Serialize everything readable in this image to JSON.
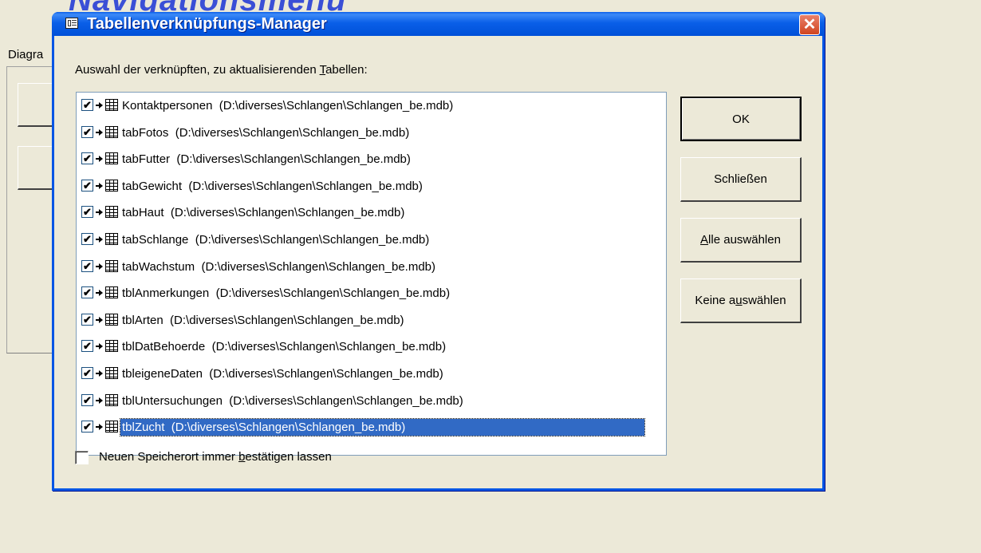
{
  "background": {
    "heading": "Navigationsmenü",
    "label": "Diagra"
  },
  "dialog": {
    "title": "Tabellenverknüpfungs-Manager",
    "prompt_before": "Auswahl der verknüpften, zu aktualisierenden ",
    "prompt_accel": "T",
    "prompt_after": "abellen:",
    "close_glyph": "✕",
    "check_glyph": "✔"
  },
  "tables": [
    {
      "name": "Kontaktpersonen",
      "path": "(D:\\diverses\\Schlangen\\Schlangen_be.mdb)",
      "checked": true
    },
    {
      "name": "tabFotos",
      "path": "(D:\\diverses\\Schlangen\\Schlangen_be.mdb)",
      "checked": true
    },
    {
      "name": "tabFutter",
      "path": "(D:\\diverses\\Schlangen\\Schlangen_be.mdb)",
      "checked": true
    },
    {
      "name": "tabGewicht",
      "path": "(D:\\diverses\\Schlangen\\Schlangen_be.mdb)",
      "checked": true
    },
    {
      "name": "tabHaut",
      "path": "(D:\\diverses\\Schlangen\\Schlangen_be.mdb)",
      "checked": true
    },
    {
      "name": "tabSchlange",
      "path": "(D:\\diverses\\Schlangen\\Schlangen_be.mdb)",
      "checked": true
    },
    {
      "name": "tabWachstum",
      "path": "(D:\\diverses\\Schlangen\\Schlangen_be.mdb)",
      "checked": true
    },
    {
      "name": "tblAnmerkungen",
      "path": "(D:\\diverses\\Schlangen\\Schlangen_be.mdb)",
      "checked": true
    },
    {
      "name": "tblArten",
      "path": "(D:\\diverses\\Schlangen\\Schlangen_be.mdb)",
      "checked": true
    },
    {
      "name": "tblDatBehoerde",
      "path": "(D:\\diverses\\Schlangen\\Schlangen_be.mdb)",
      "checked": true
    },
    {
      "name": "tbleigeneDaten",
      "path": "(D:\\diverses\\Schlangen\\Schlangen_be.mdb)",
      "checked": true
    },
    {
      "name": "tblUntersuchungen",
      "path": "(D:\\diverses\\Schlangen\\Schlangen_be.mdb)",
      "checked": true
    },
    {
      "name": "tblZucht",
      "path": "(D:\\diverses\\Schlangen\\Schlangen_be.mdb)",
      "checked": true,
      "selected": true
    }
  ],
  "buttons": {
    "ok": "OK",
    "close": "Schließen",
    "select_all_accel": "A",
    "select_all_rest": "lle auswählen",
    "select_none_before": "Keine a",
    "select_none_accel": "u",
    "select_none_after": "swählen"
  },
  "footer": {
    "checkbox_checked": false,
    "label_before": "Neuen Speicherort immer ",
    "label_accel": "b",
    "label_after": "estätigen lassen"
  },
  "colors": {
    "selection": "#316ac5",
    "titlebar": "#0055e5"
  }
}
